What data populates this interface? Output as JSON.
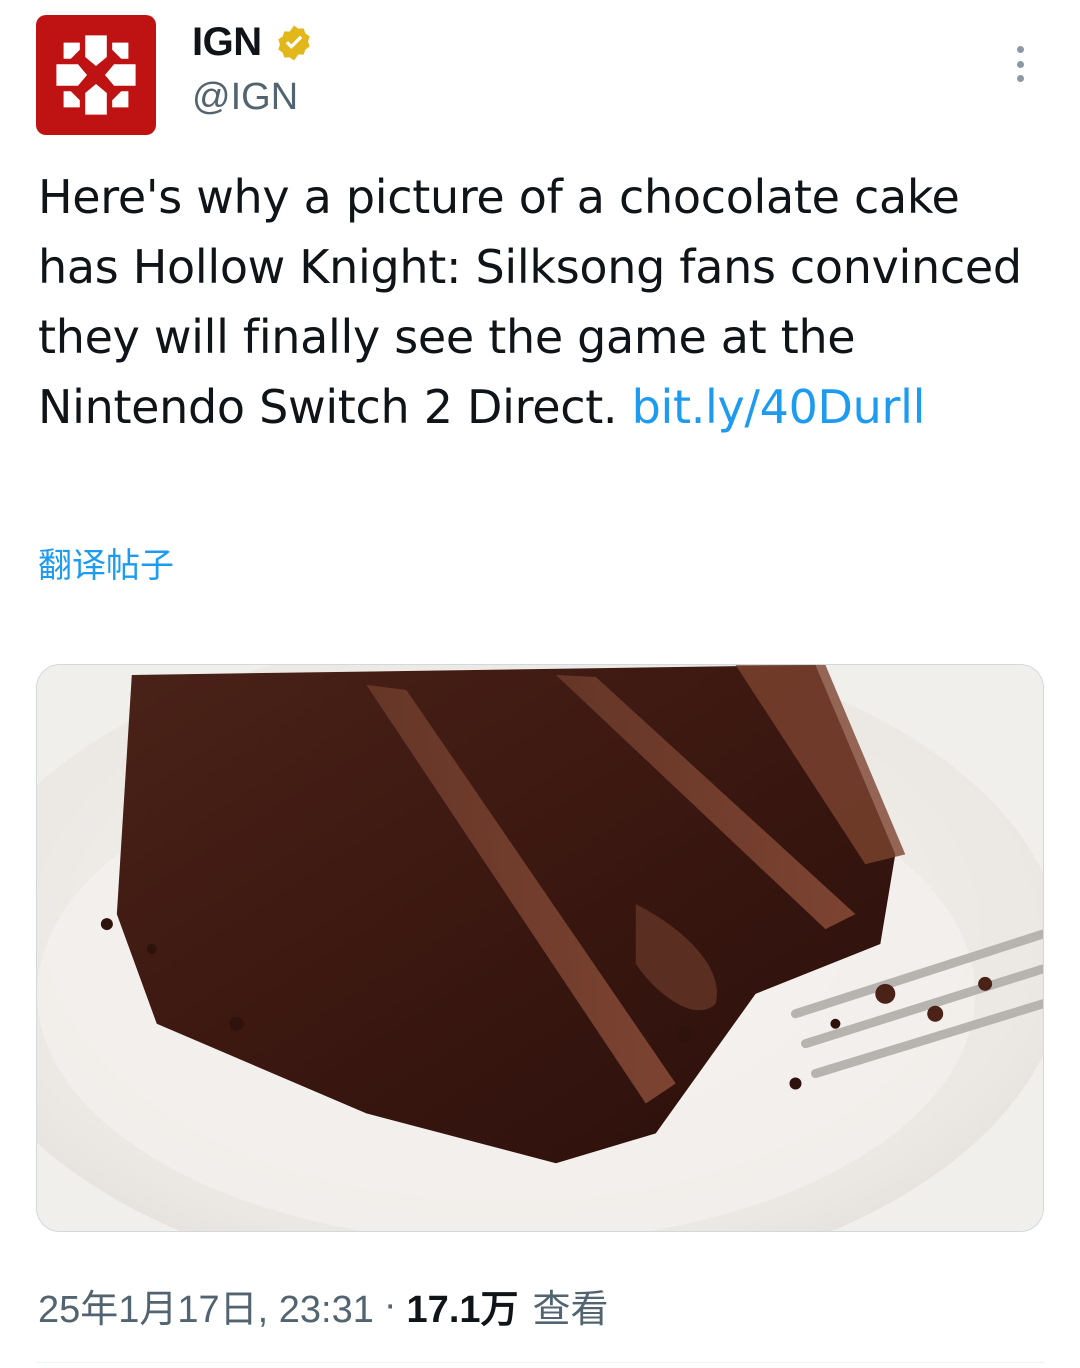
{
  "author": {
    "display_name": "IGN",
    "handle": "@IGN",
    "avatar_icon": "ign-logo-icon",
    "avatar_color": "#bf1313",
    "verified_icon": "gold-verified-badge-icon",
    "verified_color": "#e2b719"
  },
  "tweet": {
    "text": "Here's why a picture of a chocolate cake has Hollow Knight: Silksong fans convinced they will finally see the game at the Nintendo Switch 2 Direct. ",
    "link_text": "bit.ly/40Durll",
    "link_color": "#1d9bf0"
  },
  "translate_label": "翻译帖子",
  "media": {
    "image_icon": "chocolate-cake-photo"
  },
  "meta": {
    "timestamp": "25年1月17日, 23:31",
    "separator": "·",
    "view_count": "17.1万",
    "view_label": "查看"
  },
  "more_icon": "more-options-icon"
}
